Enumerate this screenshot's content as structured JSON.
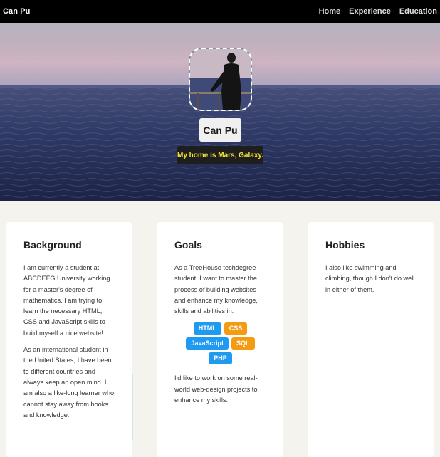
{
  "header": {
    "brand": "Can Pu",
    "nav": [
      "Home",
      "Experience",
      "Education"
    ]
  },
  "hero": {
    "name": "Can Pu",
    "tagline": "My home is Mars, Galaxy."
  },
  "cards": {
    "background": {
      "title": "Background",
      "p1": "I am currently a student at ABCDEFG University working for a master's degree of mathematics. I am trying to learn the necessary HTML, CSS and JavaScript skills to build myself a nice website!",
      "p2": "As an international student in the United States, I have been to different countries and always keep an open mind. I am also a like-long learner who cannot stay away from books and knowledge."
    },
    "goals": {
      "title": "Goals",
      "p1": "As a TreeHouse techdegree student, I want to master the process of building websites and enhance my knowledge, skills and abilities in:",
      "tags": [
        "HTML",
        "CSS",
        "JavaScript",
        "SQL",
        "PHP"
      ],
      "p2": "I'd like to work on some real-world web-design projects to enhance my skills."
    },
    "hobbies": {
      "title": "Hobbies",
      "p1": "I also like swimming and climbing, though I don't do well in either of them."
    }
  },
  "colors": {
    "tag_blue": "#1e9af0",
    "tag_orange": "#f39b12",
    "tagline_text": "#f5e630"
  }
}
